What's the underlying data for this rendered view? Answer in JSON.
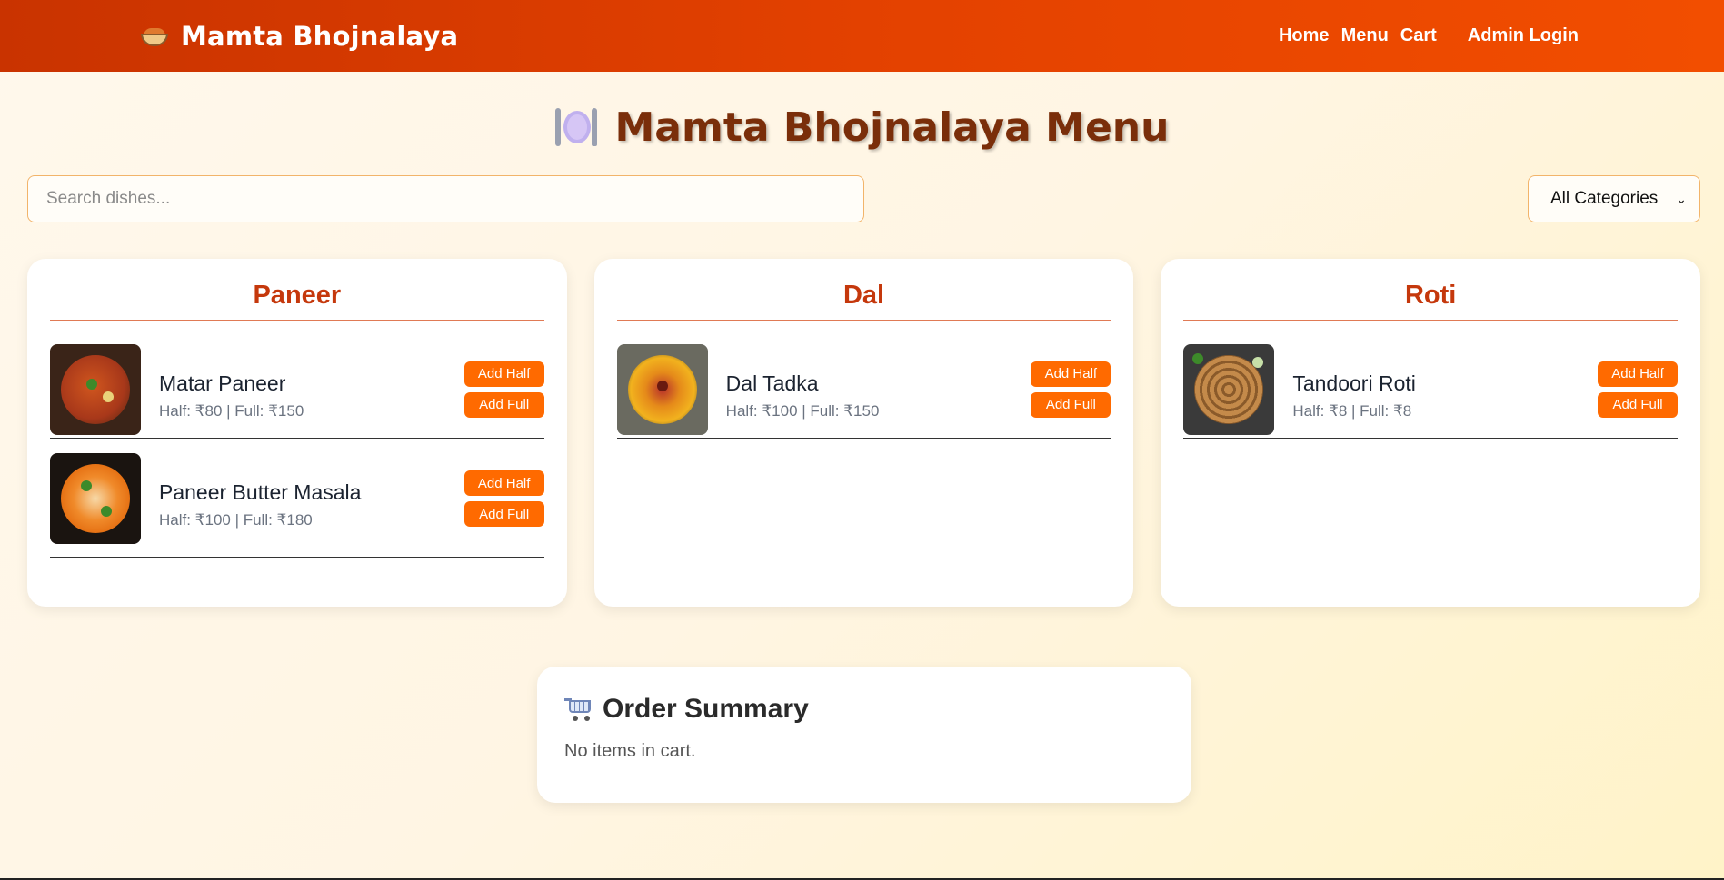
{
  "nav": {
    "brand": "Mamta Bhojnalaya",
    "brand_icon": "curry-bowl-icon",
    "links": [
      "Home",
      "Menu",
      "Cart",
      "Admin Login"
    ]
  },
  "page": {
    "title": "Mamta Bhojnalaya Menu",
    "title_icon": "plate-with-cutlery-icon"
  },
  "search": {
    "placeholder": "Search dishes..."
  },
  "category_filter": {
    "selected": "All Categories"
  },
  "categories": [
    {
      "name": "Paneer",
      "dishes": [
        {
          "name": "Matar Paneer",
          "price": "Half: ₹80 | Full: ₹150",
          "add_half": "Add Half",
          "add_full": "Add Full"
        },
        {
          "name": "Paneer Butter Masala",
          "price": "Half: ₹100 | Full: ₹180",
          "add_half": "Add Half",
          "add_full": "Add Full"
        }
      ]
    },
    {
      "name": "Dal",
      "dishes": [
        {
          "name": "Dal Tadka",
          "price": "Half: ₹100 | Full: ₹150",
          "add_half": "Add Half",
          "add_full": "Add Full"
        }
      ]
    },
    {
      "name": "Roti",
      "dishes": [
        {
          "name": "Tandoori Roti",
          "price": "Half: ₹8 | Full: ₹8",
          "add_half": "Add Half",
          "add_full": "Add Full"
        }
      ]
    }
  ],
  "order_summary": {
    "title": "Order Summary",
    "icon": "shopping-cart-icon",
    "empty_text": "No items in cart."
  },
  "colors": {
    "nav_start": "#c93300",
    "nav_end": "#f24e00",
    "accent_button": "#ff6a00",
    "category_title": "#c5380c",
    "page_title": "#7a2e0a"
  }
}
